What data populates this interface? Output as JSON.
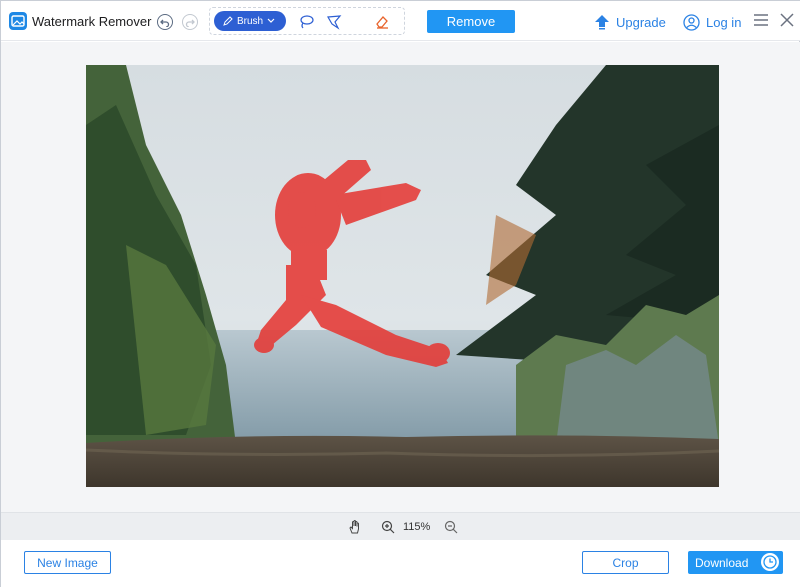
{
  "app": {
    "title": "Watermark Remover",
    "accent_color": "#2196f3"
  },
  "toolbar": {
    "undo_icon": "undo-icon",
    "redo_icon": "redo-icon",
    "brush_label": "Brush",
    "brush_dropdown_icon": "chevron-down-icon",
    "lasso_icon": "lasso-icon",
    "polygon_lasso_icon": "polygon-lasso-icon",
    "eraser_icon": "eraser-icon",
    "remove_label": "Remove"
  },
  "header": {
    "upgrade_label": "Upgrade",
    "login_label": "Log in"
  },
  "canvas": {
    "image_description_icon": "photo-jumping-person",
    "selection_color": "#e53935"
  },
  "zoom": {
    "value": "115%"
  },
  "footer": {
    "new_image_label": "New Image",
    "crop_label": "Crop",
    "download_label": "Download"
  }
}
